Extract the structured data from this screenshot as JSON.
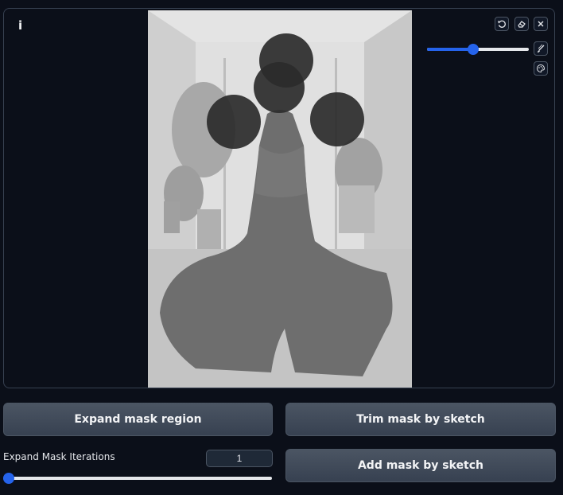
{
  "canvas": {
    "info_label": "i",
    "brush_size_percent": 45,
    "tools": {
      "undo": "undo-icon",
      "erase": "eraser-icon",
      "clear": "close-icon",
      "brush": "brush-icon",
      "color": "palette-icon"
    },
    "mask_color": "#2b2b2b"
  },
  "buttons": {
    "expand": "Expand mask region",
    "trim": "Trim mask by sketch",
    "add": "Add mask by sketch"
  },
  "expand_iterations": {
    "label": "Expand Mask Iterations",
    "value": "1",
    "slider_percent": 2
  },
  "colors": {
    "accent": "#2563eb",
    "background": "#0b0f19",
    "button": "#4b5563"
  }
}
